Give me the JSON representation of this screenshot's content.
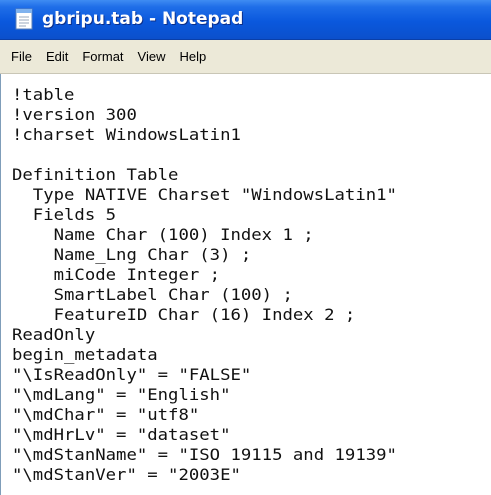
{
  "window": {
    "title": "gbripu.tab - Notepad",
    "app_icon": "notepad-icon"
  },
  "menu": {
    "items": [
      "File",
      "Edit",
      "Format",
      "View",
      "Help"
    ]
  },
  "editor": {
    "lines": [
      "!table",
      "!version 300",
      "!charset WindowsLatin1",
      "",
      "Definition Table",
      "  Type NATIVE Charset \"WindowsLatin1\"",
      "  Fields 5",
      "    Name Char (100) Index 1 ;",
      "    Name_Lng Char (3) ;",
      "    miCode Integer ;",
      "    SmartLabel Char (100) ;",
      "    FeatureID Char (16) Index 2 ;",
      "ReadOnly",
      "begin_metadata",
      "\"\\IsReadOnly\" = \"FALSE\"",
      "\"\\mdLang\" = \"English\"",
      "\"\\mdChar\" = \"utf8\"",
      "\"\\mdHrLv\" = \"dataset\"",
      "\"\\mdStanName\" = \"ISO 19115 and 19139\"",
      "\"\\mdStanVer\" = \"2003E\""
    ]
  }
}
